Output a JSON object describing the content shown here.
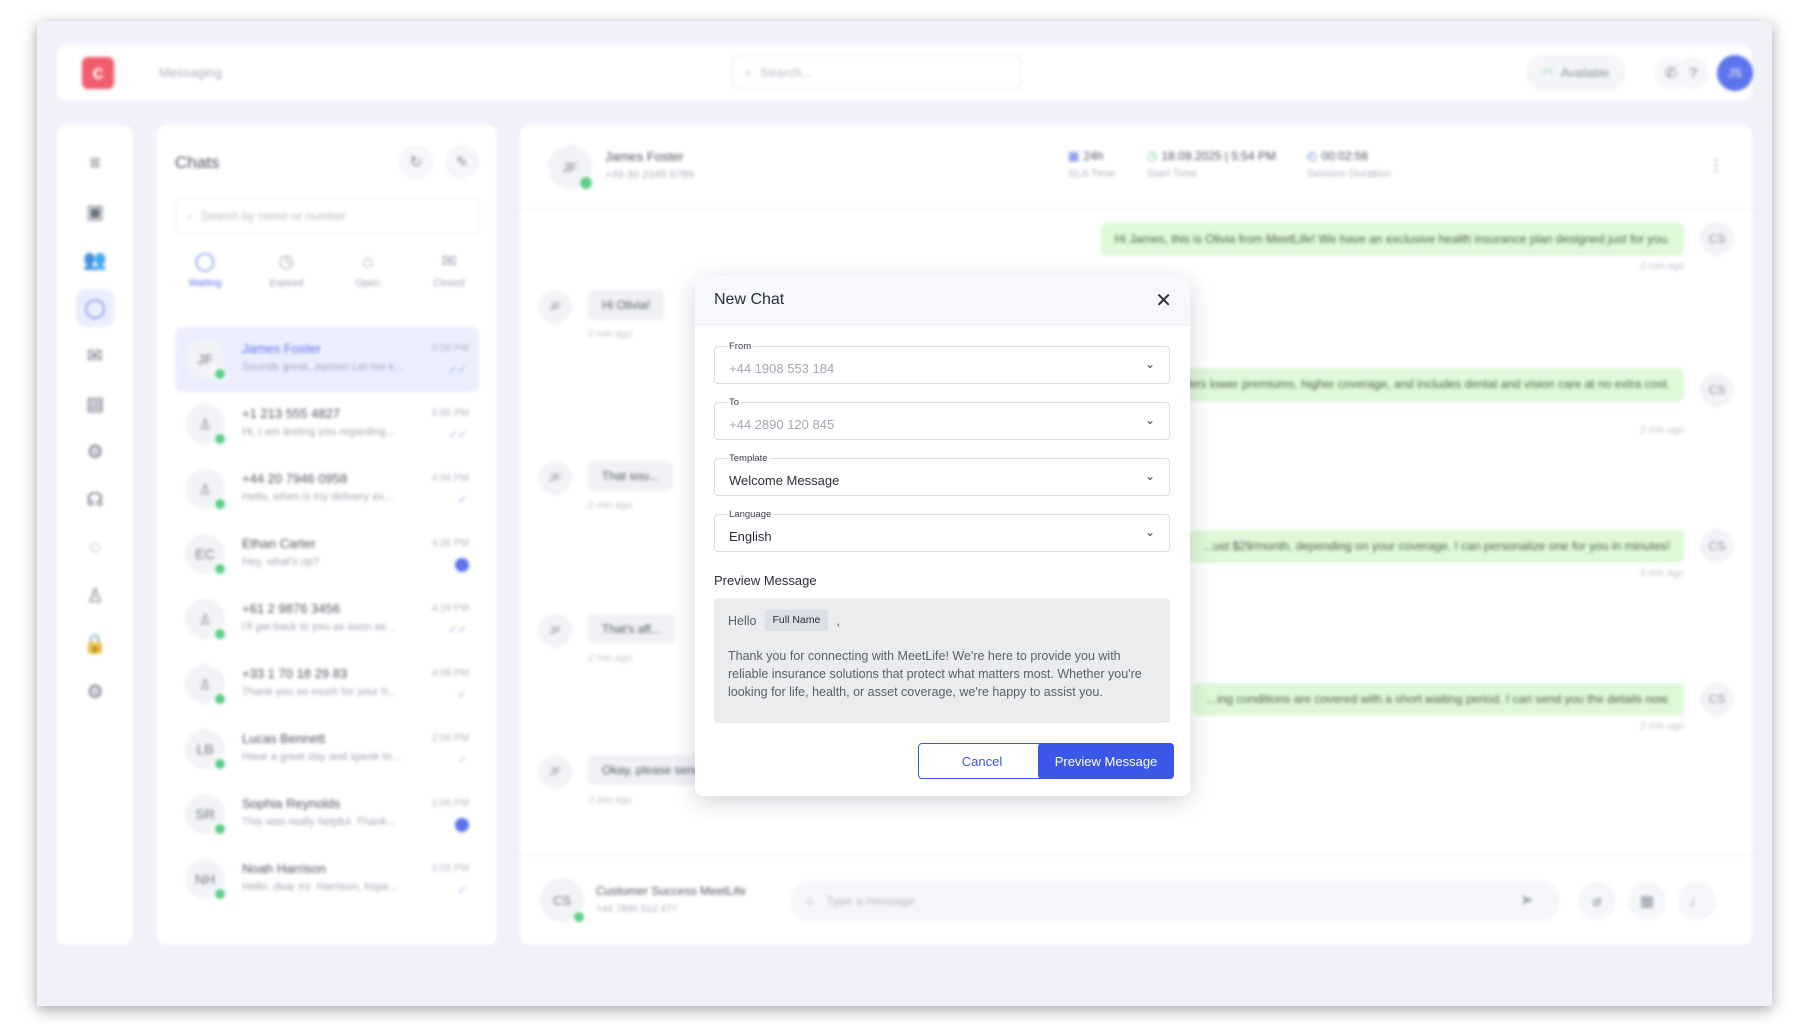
{
  "topbar": {
    "app_title": "Messaging",
    "search_placeholder": "Search...",
    "status": "Available",
    "user_initials": "JS"
  },
  "chats": {
    "title": "Chats",
    "search_placeholder": "Search by name or number",
    "tabs": [
      {
        "label": "Waiting",
        "icon": "chat-bubble-icon"
      },
      {
        "label": "Expired",
        "icon": "clock-icon"
      },
      {
        "label": "Open",
        "icon": "open-envelope-icon"
      },
      {
        "label": "Closed",
        "icon": "envelope-icon"
      }
    ],
    "items": [
      {
        "initials": "JF",
        "name": "James Foster",
        "preview": "Sounds great, James! Let me k...",
        "time": "5:58 PM",
        "status": "read"
      },
      {
        "initials": "",
        "name": "+1 213 555 4827",
        "preview": "Hi, I am texting you regarding...",
        "time": "5:55 PM",
        "status": "read"
      },
      {
        "initials": "",
        "name": "+44 20 7946 0958",
        "preview": "Hello, when is my delivery ex...",
        "time": "4:58 PM",
        "status": "sent"
      },
      {
        "initials": "EC",
        "name": "Ethan Carter",
        "preview": "Hey, what's up?",
        "time": "4:36 PM",
        "status": "unread"
      },
      {
        "initials": "",
        "name": "+61 2 9876 3456",
        "preview": "I'll get back to you as soon as...",
        "time": "4:19 PM",
        "status": "read"
      },
      {
        "initials": "",
        "name": "+33 1 70 18 29 83",
        "preview": "Thank you so much for your h...",
        "time": "4:08 PM",
        "status": "sent"
      },
      {
        "initials": "LB",
        "name": "Lucas Bennett",
        "preview": "Have a great day and speak to...",
        "time": "2:09 PM",
        "status": "sent"
      },
      {
        "initials": "SR",
        "name": "Sophia Reynolds",
        "preview": "This was really helpful. Thank...",
        "time": "2:06 PM",
        "status": "unread"
      },
      {
        "initials": "NH",
        "name": "Noah Harrison",
        "preview": "Hello, dear mr. Harrison, hope...",
        "time": "2:05 PM",
        "status": "sent"
      }
    ]
  },
  "conversation": {
    "contact_initials": "JF",
    "contact_name": "James Foster",
    "contact_phone": "+49 30 2345 6789",
    "stats": [
      {
        "value": "24h",
        "label": "SLA Time",
        "icon": "calendar-icon"
      },
      {
        "value": "18.09.2025 | 5:54 PM",
        "label": "Start Time",
        "icon": "clock-icon"
      },
      {
        "value": "00:02:56",
        "label": "Session Duration",
        "icon": "timer-icon"
      }
    ],
    "agent_initials": "CS",
    "messages": {
      "out1": "Hi James, this is Olivia from MeetLife! We have an exclusive health insurance plan designed just for you.",
      "in1": "Hi Olivia!",
      "out2": "...lan offers lower premiums, higher coverage, and includes dental and vision care at no extra cost.",
      "in2": "That sou...",
      "out3": "...ust $29/month, depending on your coverage. I can personalize one for you in minutes!",
      "in3": "That's aff...",
      "out4": "...ing conditions are covered with a short waiting period. I can send you the details now.",
      "in4": "Okay, please send me the details, and I'll review them.",
      "meta": "2 min ago"
    },
    "composer": {
      "agent_name": "Customer Success MeetLife",
      "agent_phone": "+44 7890 512 477",
      "placeholder": "Type a message"
    }
  },
  "modal": {
    "title": "New Chat",
    "from_label": "From",
    "from_value": "+44 1908 553 184",
    "to_label": "To",
    "to_value": "+44 2890 120 845",
    "template_label": "Template",
    "template_value": "Welcome Message",
    "language_label": "Language",
    "language_value": "English",
    "preview_title": "Preview Message",
    "preview_hello": "Hello",
    "preview_tag": "Full Name",
    "preview_comma": ",",
    "preview_body": "Thank you for connecting with MeetLife! We're here to provide you with reliable insurance solutions that protect what matters most. Whether you're looking for life, health, or asset coverage, we're happy to assist you.",
    "cancel_label": "Cancel",
    "preview_button_label": "Preview Message"
  },
  "colors": {
    "accent": "#3a57e8",
    "logo": "#ee3a4e",
    "online": "#37c46c",
    "outgoing_bubble": "#d8f7cf"
  }
}
